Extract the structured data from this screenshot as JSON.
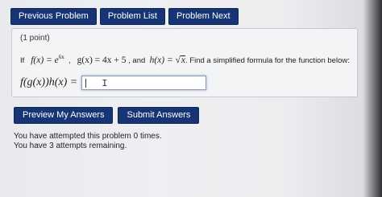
{
  "nav": {
    "previous": "Previous Problem",
    "list": "Problem List",
    "next": "Problem Next"
  },
  "problem": {
    "points": "(1 point)",
    "if": "If",
    "f_def": "f(x) = e",
    "f_exp": "6x",
    "g_def": "g(x) = 4x + 5",
    "and": ", and",
    "h_def_prefix": "h(x) =",
    "h_radicand": "x",
    "instruction": ". Find a simplified formula for the function below:",
    "answer_label": "f(g(x))h(x) ="
  },
  "input": {
    "value": "",
    "placeholder": ""
  },
  "actions": {
    "preview": "Preview My Answers",
    "submit": "Submit Answers"
  },
  "status": {
    "attempted": "You have attempted this problem 0 times.",
    "remaining": "You have 3 attempts remaining."
  },
  "colors": {
    "button_bg": "#173574",
    "button_text": "#ffffff",
    "panel_bg": "#f3f4f6",
    "page_bg": "#eeeff2"
  }
}
